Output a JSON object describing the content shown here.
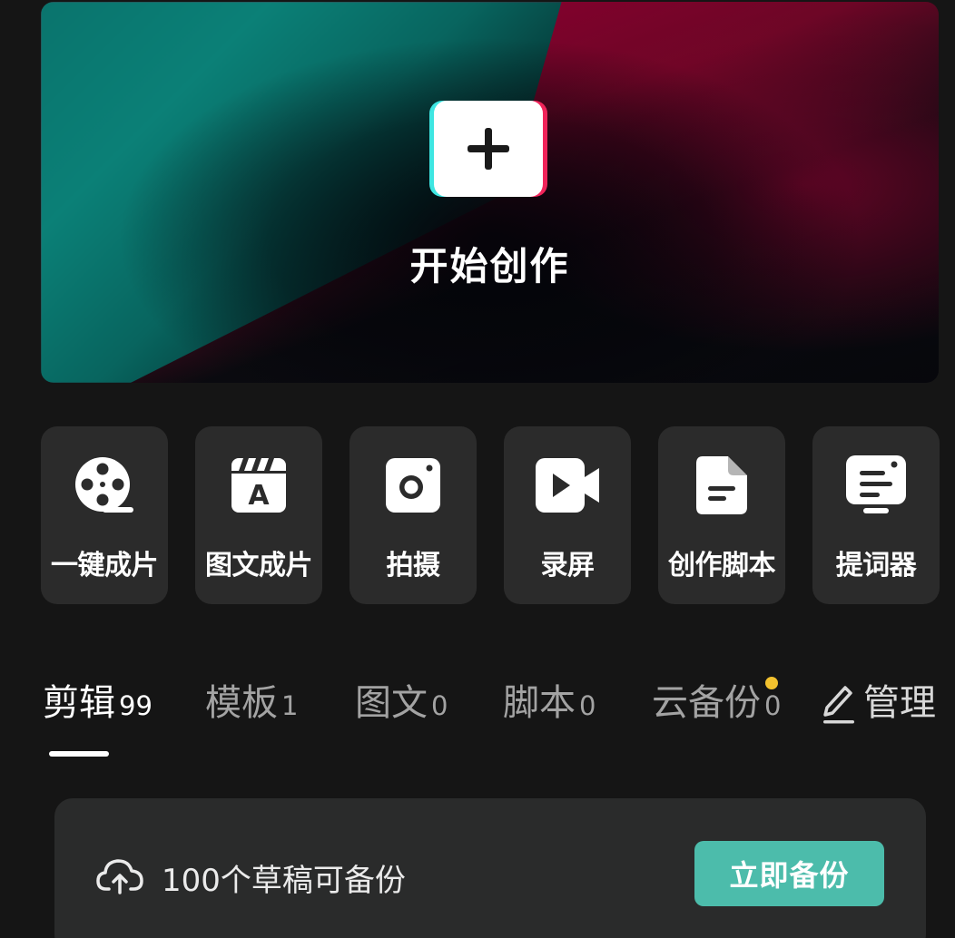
{
  "hero": {
    "label": "开始创作",
    "icon": "plus-icon"
  },
  "tools": [
    {
      "label": "一键成片",
      "icon": "film-reel-icon"
    },
    {
      "label": "图文成片",
      "icon": "text-clapper-icon"
    },
    {
      "label": "拍摄",
      "icon": "camera-icon"
    },
    {
      "label": "录屏",
      "icon": "video-camera-icon"
    },
    {
      "label": "创作脚本",
      "icon": "document-icon"
    },
    {
      "label": "提词器",
      "icon": "teleprompter-icon"
    }
  ],
  "tabs": [
    {
      "label": "剪辑",
      "count": "99",
      "active": true
    },
    {
      "label": "模板",
      "count": "1",
      "active": false
    },
    {
      "label": "图文",
      "count": "0",
      "active": false
    },
    {
      "label": "脚本",
      "count": "0",
      "active": false
    },
    {
      "label": "云备份",
      "count": "0",
      "active": false,
      "badge": true
    }
  ],
  "manage": {
    "label": "管理",
    "icon": "edit-pencil-icon"
  },
  "backup": {
    "text": "100个草稿可备份",
    "button_label": "立即备份",
    "icon": "cloud-upload-icon"
  },
  "colors": {
    "background": "#151515",
    "card": "#2b2b2b",
    "accent": "#4cbcab",
    "badge": "#f2c12e",
    "teal": "#0b8077",
    "magenta": "#86002e"
  }
}
